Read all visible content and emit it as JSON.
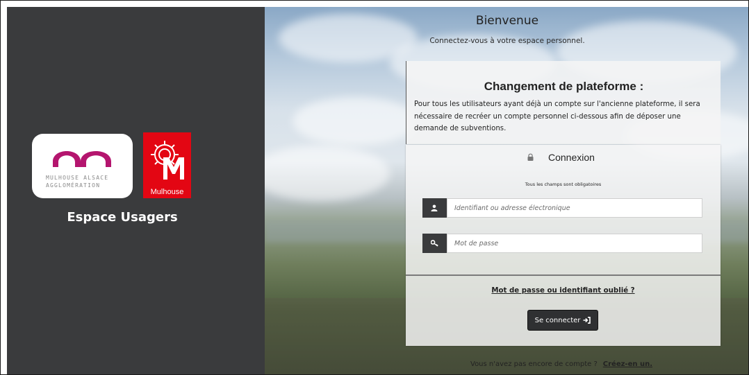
{
  "brand": {
    "agglo_line1": "MULHOUSE ALSACE",
    "agglo_line2": "AGGLOMÉRATION",
    "city_label": "Mulhouse",
    "space_title": "Espace Usagers",
    "colors": {
      "agglo_magenta": "#b4156e",
      "city_red": "#e30613",
      "panel_dark": "#3a3b3d"
    }
  },
  "welcome": {
    "title": "Bienvenue",
    "subtitle": "Connectez-vous à votre espace personnel."
  },
  "notice": {
    "title": "Changement de plateforme :",
    "body": "Pour tous les utilisateurs ayant déjà un compte sur l'ancienne plateforme, il sera nécessaire de recréer un compte personnel ci-dessous afin de déposer une demande de subventions."
  },
  "login": {
    "heading": "Connexion",
    "heading_icon": "lock-icon",
    "required_note": "Tous les champs sont obligatoires",
    "username": {
      "placeholder": "Identifiant ou adresse électronique",
      "value": "",
      "icon": "user-icon"
    },
    "password": {
      "placeholder": "Mot de passe",
      "value": "",
      "icon": "key-icon"
    },
    "forgot_label": "Mot de passe ou identifiant oublié ?",
    "submit_label": "Se connecter",
    "submit_icon": "sign-in-icon"
  },
  "signup": {
    "prompt": "Vous n'avez pas encore de compte ?",
    "link_label": "Créez-en un."
  }
}
